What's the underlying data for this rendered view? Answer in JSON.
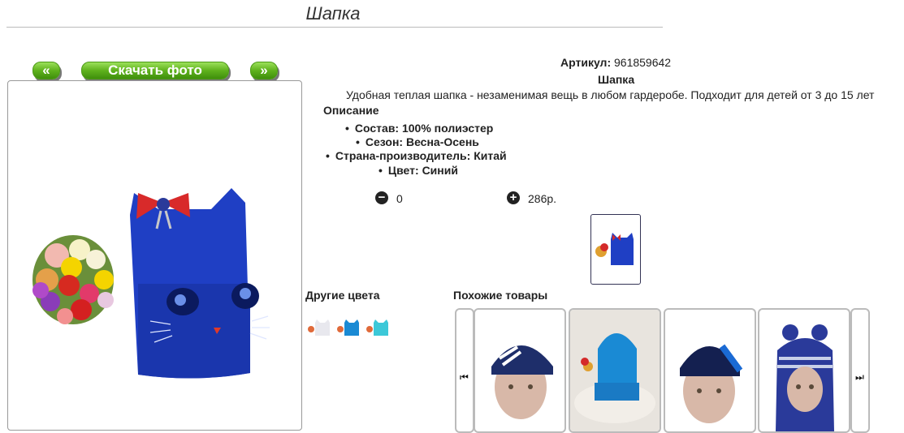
{
  "page": {
    "title": "Шапка"
  },
  "gallery": {
    "prev_label": "«",
    "download_label": "Скачать фото",
    "next_label": "»"
  },
  "product": {
    "sku_label": "Артикул:",
    "sku_value": "961859642",
    "name": "Шапка",
    "description": "Удобная теплая шапка - незаменимая вещь в любом гардеробе. Подходит для детей от 3 до 15 лет",
    "description_heading": "Описание",
    "specs": [
      "Состав: 100% полиэстер",
      "Сезон: Весна-Осень",
      "Страна-производитель: Китай",
      "Цвет: Синий"
    ]
  },
  "cart": {
    "quantity": "0",
    "price": "286р.",
    "minus_icon": "minus-circle-icon",
    "plus_icon": "plus-circle-icon"
  },
  "sections": {
    "other_colors": "Другие цвета",
    "similar_products": "Похожие товары"
  },
  "colors": {
    "hat_blue": "#1f3fc4",
    "button_green": "#5fb21d"
  }
}
